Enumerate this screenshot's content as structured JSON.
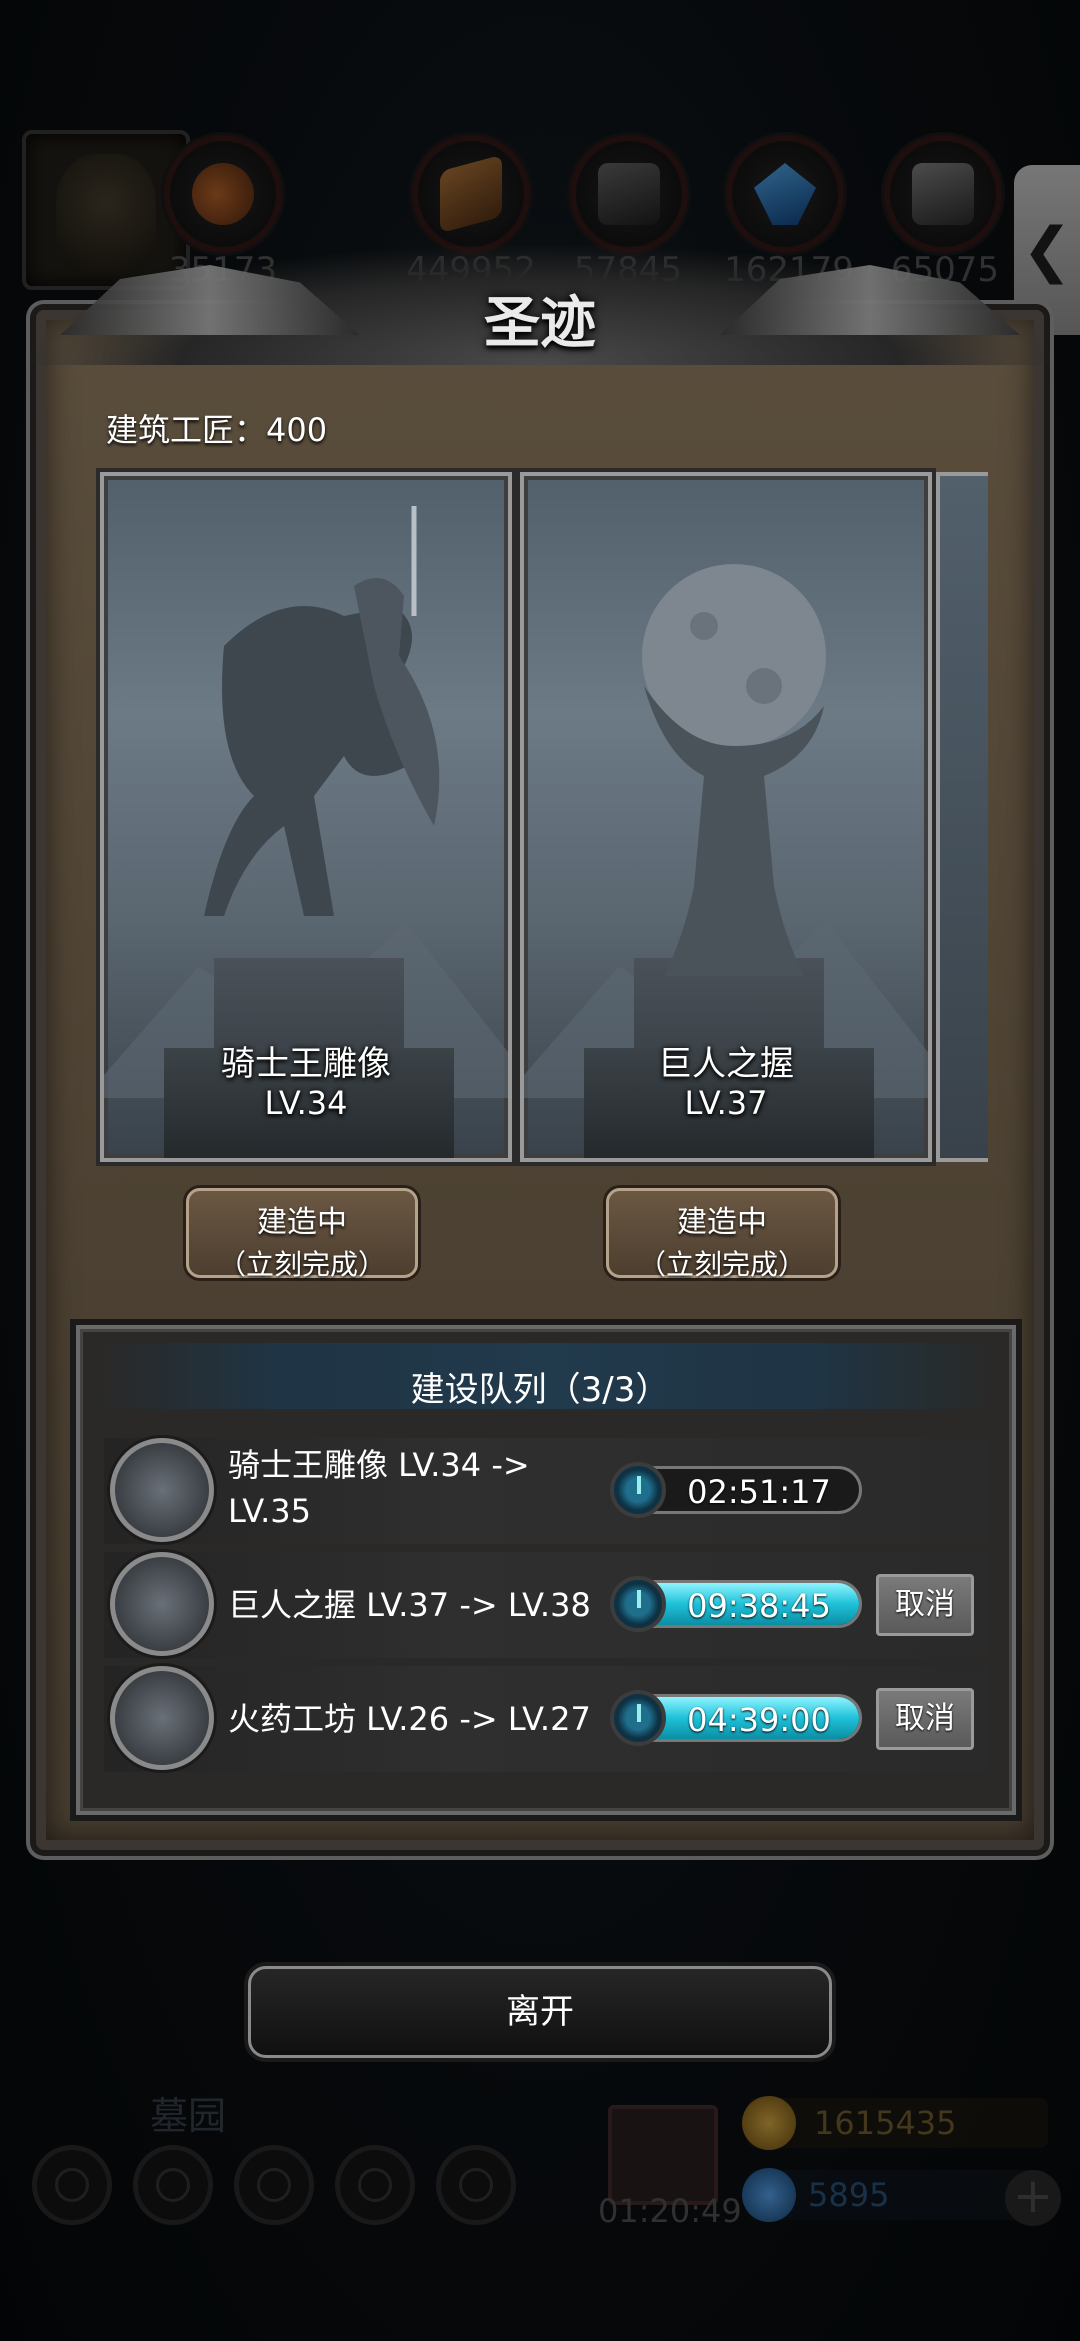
{
  "hud": {
    "resources": [
      {
        "icon": "meat-icon",
        "value": "35173"
      },
      {
        "icon": "wood-icon",
        "value": "449952"
      },
      {
        "icon": "iron-icon",
        "value": "57845"
      },
      {
        "icon": "crystal-icon",
        "value": "162179"
      },
      {
        "icon": "steel-icon",
        "value": "65075"
      }
    ],
    "side_tab_glyph": "❮",
    "graveyard_label": "墓园",
    "gift_timer": "01:20:49",
    "gold": "1615435",
    "gems": "5895",
    "plus": "+"
  },
  "panel": {
    "title": "圣迹",
    "builders": "建筑工匠：400",
    "cards": [
      {
        "name": "骑士王雕像",
        "level": "LV.34",
        "button_line1": "建造中",
        "button_line2": "（立刻完成）"
      },
      {
        "name": "巨人之握",
        "level": "LV.37",
        "button_line1": "建造中",
        "button_line2": "（立刻完成）"
      }
    ]
  },
  "queue": {
    "title": "建设队列（3/3）",
    "rows": [
      {
        "label_line1": "骑士王雕像 LV.34 ->",
        "label_line2": "LV.35",
        "timer": "02:51:17",
        "progress": 0.0,
        "cancel": ""
      },
      {
        "label_line1": "巨人之握 LV.37 -> LV.38",
        "label_line2": "",
        "timer": "09:38:45",
        "progress": 1.0,
        "cancel": "取消"
      },
      {
        "label_line1": "火药工坊 LV.26 -> LV.27",
        "label_line2": "",
        "timer": "04:39:00",
        "progress": 1.0,
        "cancel": "取消"
      }
    ]
  },
  "leave_label": "离开",
  "colors": {
    "accent_timer": "#1fc1d8",
    "panel_bg": "#4c4132",
    "gold": "#d6a234",
    "gem": "#2d7fc1"
  }
}
